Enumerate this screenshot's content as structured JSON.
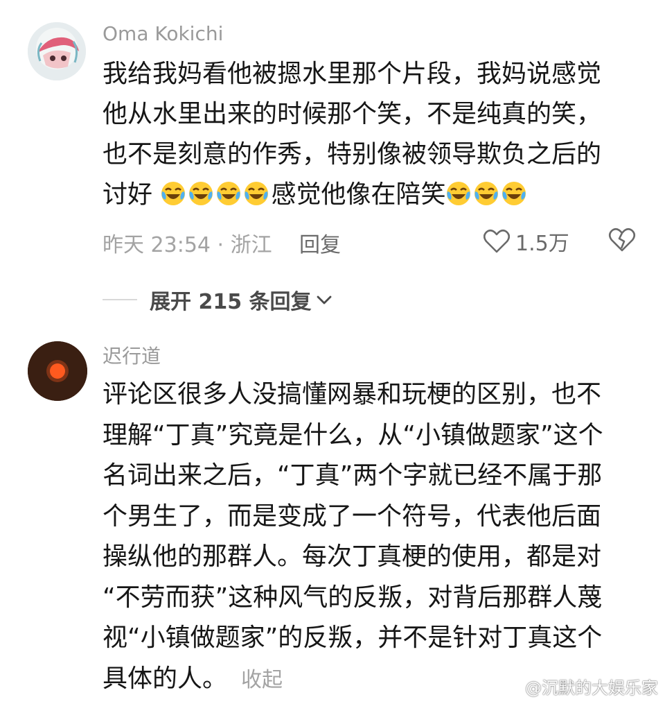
{
  "comments": [
    {
      "username": "Oma Kokichi",
      "lines": [
        "我给我妈看他被摁水里那个片段，我妈说感觉",
        "他从水里出来的时候那个笑，不是纯真的笑，",
        "也不是刻意的作秀，特别像被领导欺负之后的"
      ],
      "last_line_start": "讨好",
      "last_line_mid": "感觉他像在陪笑",
      "emoji": "face-with-tears-of-joy",
      "meta": "昨天 23:54 · 浙江",
      "reply_label": "回复",
      "likes": "1.5万",
      "expand_label": "展开 215 条回复"
    },
    {
      "username": "迟行道",
      "lines": [
        "评论区很多人没搞懂网暴和玩梗的区别，也不",
        "理解“丁真”究竟是什么，从“小镇做题家”这个",
        "名词出来之后，“丁真”两个字就已经不属于那",
        "个男生了，而是变成了一个符号，代表他后面",
        "操纵他的那群人。每次丁真梗的使用，都是对",
        "“不劳而获”这种风气的反叛，对背后那群人蔑",
        "视“小镇做题家”的反叛，并不是针对丁真这个"
      ],
      "last_line": "具体的人。",
      "collapse_label": "收起"
    }
  ],
  "watermark": "@沉默的大娱乐家",
  "colors": {
    "username": "#9a9a9a",
    "meta": "#a3a3a3",
    "text": "#161616",
    "avatar2_bg": "#3a1f12",
    "avatar2_dot": "#ff5a1f"
  }
}
